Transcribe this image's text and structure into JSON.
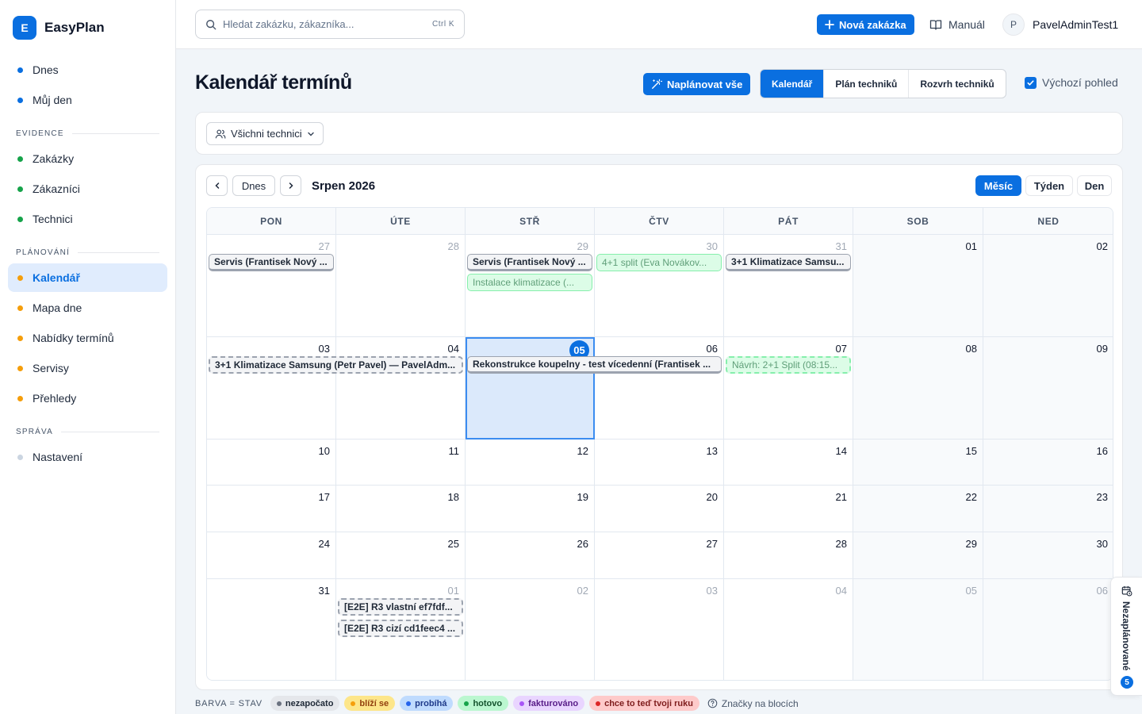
{
  "brand": {
    "logo_letter": "E",
    "name": "EasyPlan"
  },
  "sidebar": {
    "items_top": [
      {
        "label": "Dnes",
        "color": "#0a6fe0"
      },
      {
        "label": "Můj den",
        "color": "#0a6fe0"
      }
    ],
    "section_evidence": "EVIDENCE",
    "items_evidence": [
      {
        "label": "Zakázky",
        "color": "#16a34a"
      },
      {
        "label": "Zákazníci",
        "color": "#16a34a"
      },
      {
        "label": "Technici",
        "color": "#16a34a"
      }
    ],
    "section_planning": "PLÁNOVÁNÍ",
    "items_planning": [
      {
        "label": "Kalendář",
        "color": "#f59e0b",
        "active": true
      },
      {
        "label": "Mapa dne",
        "color": "#f59e0b"
      },
      {
        "label": "Nabídky termínů",
        "color": "#f59e0b"
      },
      {
        "label": "Servisy",
        "color": "#f59e0b"
      },
      {
        "label": "Přehledy",
        "color": "#f59e0b"
      }
    ],
    "section_admin": "SPRÁVA",
    "items_admin": [
      {
        "label": "Nastavení",
        "color": "#cbd5e1"
      }
    ]
  },
  "topbar": {
    "search_placeholder": "Hledat zakázku, zákazníka...",
    "search_shortcut": "Ctrl K",
    "new_order": "Nová zakázka",
    "manual": "Manuál",
    "user_initial": "P",
    "user_name": "PavelAdminTest1"
  },
  "page": {
    "title": "Kalendář termínů",
    "plan_all": "Naplánovat vše",
    "views": [
      "Kalendář",
      "Plán techniků",
      "Rozvrh techniků"
    ],
    "active_view": 0,
    "default_view_label": "Výchozí pohled",
    "default_view_checked": true,
    "technician_filter": "Všichni technici"
  },
  "calendar": {
    "today_label": "Dnes",
    "month_label": "Srpen 2026",
    "range_views": [
      "Měsíc",
      "Týden",
      "Den"
    ],
    "active_range_view": 0,
    "weekdays": [
      "PON",
      "ÚTE",
      "STŘ",
      "ČTV",
      "PÁT",
      "SOB",
      "NED"
    ],
    "weeks": [
      [
        {
          "day": "27",
          "muted": true
        },
        {
          "day": "28",
          "muted": true
        },
        {
          "day": "29",
          "muted": true
        },
        {
          "day": "30",
          "muted": true
        },
        {
          "day": "31",
          "muted": true
        },
        {
          "day": "01"
        },
        {
          "day": "02"
        }
      ],
      [
        {
          "day": "03"
        },
        {
          "day": "04"
        },
        {
          "day": "05",
          "today": true
        },
        {
          "day": "06"
        },
        {
          "day": "07"
        },
        {
          "day": "08"
        },
        {
          "day": "09"
        }
      ],
      [
        {
          "day": "10"
        },
        {
          "day": "11"
        },
        {
          "day": "12"
        },
        {
          "day": "13"
        },
        {
          "day": "14"
        },
        {
          "day": "15"
        },
        {
          "day": "16"
        }
      ],
      [
        {
          "day": "17"
        },
        {
          "day": "18"
        },
        {
          "day": "19"
        },
        {
          "day": "20"
        },
        {
          "day": "21"
        },
        {
          "day": "22"
        },
        {
          "day": "23"
        }
      ],
      [
        {
          "day": "24"
        },
        {
          "day": "25"
        },
        {
          "day": "26"
        },
        {
          "day": "27"
        },
        {
          "day": "28"
        },
        {
          "day": "29"
        },
        {
          "day": "30"
        }
      ],
      [
        {
          "day": "31"
        },
        {
          "day": "01",
          "muted": true
        },
        {
          "day": "02",
          "muted": true
        },
        {
          "day": "03",
          "muted": true
        },
        {
          "day": "04",
          "muted": true
        },
        {
          "day": "05",
          "muted": true
        },
        {
          "day": "06",
          "muted": true
        }
      ]
    ],
    "events": [
      {
        "label": "Servis (Frantisek Nový ...",
        "week": 0,
        "col": 0,
        "span": 1,
        "lane": 0,
        "style": "gray"
      },
      {
        "label": "Servis (Frantisek Nový ...",
        "week": 0,
        "col": 2,
        "span": 1,
        "lane": 0,
        "style": "gray"
      },
      {
        "label": "Instalace klimatizace (...",
        "week": 0,
        "col": 2,
        "span": 1,
        "lane": 1,
        "style": "green"
      },
      {
        "label": "4+1 split (Eva Novákov...",
        "week": 0,
        "col": 3,
        "span": 1,
        "lane": 0,
        "style": "green"
      },
      {
        "label": "3+1 Klimatizace Samsu...",
        "week": 0,
        "col": 4,
        "span": 1,
        "lane": 0,
        "style": "gray"
      },
      {
        "label": "3+1 Klimatizace Samsung (Petr Pavel) — PavelAdm...",
        "week": 1,
        "col": 0,
        "span": 2,
        "lane": 0,
        "style": "dashed-gray"
      },
      {
        "label": "Rekonstrukce koupelny - test vícedenní (Frantisek ...",
        "week": 1,
        "col": 2,
        "span": 2,
        "lane": 0,
        "style": "gray"
      },
      {
        "label": "Návrh: 2+1 Split (08:15...",
        "week": 1,
        "col": 4,
        "span": 1,
        "lane": 0,
        "style": "dashed-green"
      },
      {
        "label": "[E2E] R3 vlastní ef7fdf...",
        "week": 5,
        "col": 1,
        "span": 1,
        "lane": 0,
        "style": "dashed-gray"
      },
      {
        "label": "[E2E] R3 cizí cd1feec4 ...",
        "week": 5,
        "col": 1,
        "span": 1,
        "lane": 1,
        "style": "dashed-gray"
      }
    ]
  },
  "legend": {
    "label": "BARVA = STAV",
    "items": [
      {
        "label": "nezapočato",
        "bg": "#e5e7eb",
        "dot": "#6b7280",
        "fg": "#1f2937"
      },
      {
        "label": "blíží se",
        "bg": "#fde68a",
        "dot": "#f59e0b",
        "fg": "#92400e"
      },
      {
        "label": "probíhá",
        "bg": "#bfdbfe",
        "dot": "#2563eb",
        "fg": "#1e3a8a"
      },
      {
        "label": "hotovo",
        "bg": "#bbf7d0",
        "dot": "#16a34a",
        "fg": "#14532d"
      },
      {
        "label": "fakturováno",
        "bg": "#e9d5ff",
        "dot": "#a855f7",
        "fg": "#581c87"
      },
      {
        "label": "chce to teď tvoji ruku",
        "bg": "#fecaca",
        "dot": "#dc2626",
        "fg": "#7f1d1d"
      }
    ],
    "hint": "Značky na blocích"
  },
  "unscheduled": {
    "label": "Nezaplánované",
    "count": "5"
  }
}
